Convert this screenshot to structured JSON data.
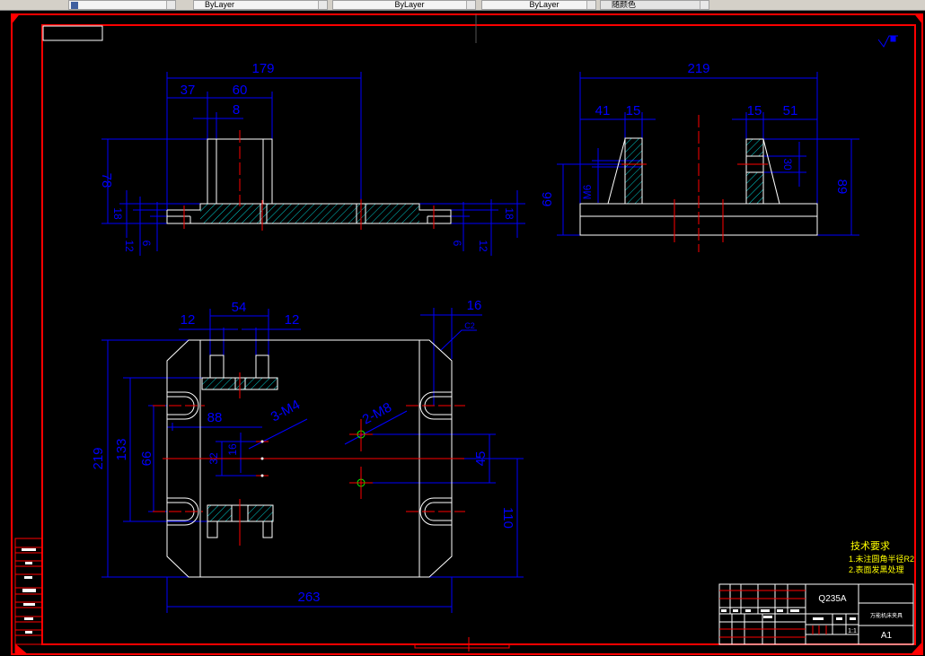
{
  "toolbar": {
    "dropdowns": [
      {
        "label": "",
        "icon": "layer-icon"
      },
      {
        "label": "ByLayer"
      },
      {
        "label": "ByLayer"
      },
      {
        "label": "ByLayer"
      },
      {
        "label": "随颜色"
      }
    ]
  },
  "colors": {
    "background": "#000000",
    "frame": "#ff0000",
    "dimension": "#0000ff",
    "geometry": "#ffffff",
    "hatch": "#00ffff",
    "note": "#ffff00"
  },
  "front_view": {
    "d179": "179",
    "d37": "37",
    "d60": "60",
    "d8": "8",
    "d78": "78",
    "d18l": "18",
    "d12l": "12",
    "d6l": "6",
    "d18r": "18",
    "d12r": "12",
    "d6r": "6"
  },
  "side_view": {
    "d219": "219",
    "d41": "41",
    "d15a": "15",
    "d15b": "15",
    "d51": "51",
    "d66": "66",
    "d89": "89",
    "m6": "M6",
    "d30": "30"
  },
  "top_view": {
    "d54": "54",
    "d12a": "12",
    "d12b": "12",
    "d16": "16",
    "c2": "C2",
    "d219": "219",
    "d133": "133",
    "d99": "99",
    "d88": "88",
    "m4": "3-M4",
    "m8": "2-M8",
    "d32": "32",
    "d16b": "16",
    "d45": "45",
    "d110": "110",
    "d263": "263"
  },
  "tech_requirements": {
    "title": "技术要求",
    "item1": "1.未注圆角半径R2",
    "item2": "2.表面发黑处理"
  },
  "title_block": {
    "material": "Q235A",
    "drawing_name": "万能机床夹具",
    "scale": "1:1",
    "sheet_size": "A1"
  }
}
